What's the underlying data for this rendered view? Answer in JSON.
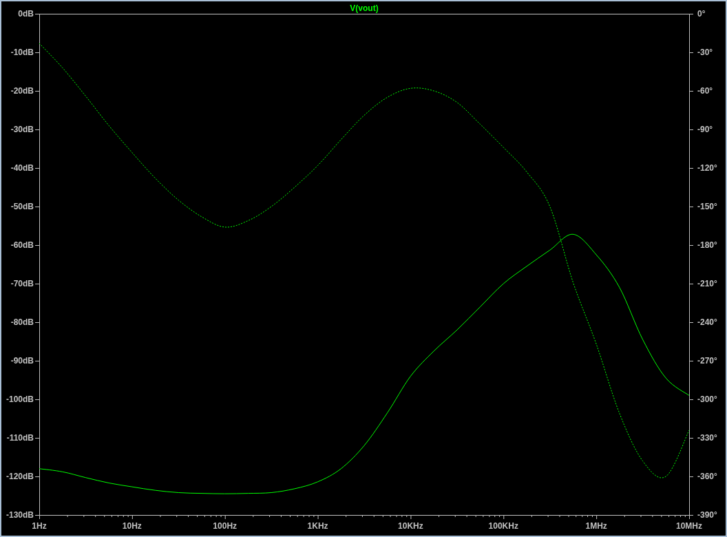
{
  "plot": {
    "magnitude_chart": {
      "chart_data": {
        "type": "line",
        "title": "V(vout)",
        "categories": [
          "1Hz",
          null,
          null,
          null,
          "10Hz",
          null,
          null,
          null,
          "100Hz",
          null,
          null,
          null,
          "1KHz",
          null,
          null,
          null,
          "10KHz",
          null,
          null,
          null,
          "100KHz",
          null,
          null,
          null,
          "1MHz",
          null,
          null,
          null,
          "10MHz"
        ],
        "series": [
          {
            "color": "#00ff00",
            "line_style": "solid",
            "values": [
              -118,
              -118.8,
              -120.3,
              -121.7,
              -122.7,
              -123.6,
              -124.2,
              -124.4,
              -124.5,
              -124.4,
              -124.2,
              -123.2,
              -121.4,
              -118,
              -112,
              -103.5,
              -94,
              -87.5,
              -82,
              -76,
              -70,
              -65.5,
              -61.3,
              -57.2,
              -62.5,
              -71,
              -84.5,
              -94.5,
              -99
            ]
          }
        ],
        "ylim": [
          -130,
          0
        ],
        "yticks": [
          {
            "value": 0,
            "label": "0dB"
          },
          {
            "value": -10,
            "label": "-10dB"
          },
          {
            "value": -20,
            "label": "-20dB"
          },
          {
            "value": -30,
            "label": "-30dB"
          },
          {
            "value": -40,
            "label": "-40dB"
          },
          {
            "value": -50,
            "label": "-50dB"
          },
          {
            "value": -60,
            "label": "-60dB"
          },
          {
            "value": -70,
            "label": "-70dB"
          },
          {
            "value": -80,
            "label": "-80dB"
          },
          {
            "value": -90,
            "label": "-90dB"
          },
          {
            "value": -100,
            "label": "-100dB"
          },
          {
            "value": -110,
            "label": "-110dB"
          },
          {
            "value": -120,
            "label": "-120dB"
          },
          {
            "value": -130,
            "label": "-130dB"
          }
        ]
      }
    },
    "phase_chart": {
      "chart_data": {
        "type": "line",
        "categories": [
          null,
          null,
          null,
          null,
          null,
          null,
          null,
          null,
          null,
          null,
          null,
          null,
          null,
          null,
          null,
          null,
          null,
          null,
          null,
          null,
          null,
          null,
          null,
          null,
          null,
          null,
          null,
          null,
          null
        ],
        "series": [
          {
            "color": "#00ff00",
            "line_style": "dashed",
            "values": [
              -23,
              -42,
              -64,
              -87,
              -108,
              -128,
              -145,
              -158,
              -166,
              -161,
              -150,
              -135,
              -118,
              -98,
              -79,
              -65,
              -58,
              -60,
              -69,
              -86,
              -104,
              -123,
              -150,
              -209,
              -257,
              -311,
              -348,
              -360,
              -324
            ]
          }
        ],
        "ylim": [
          -390,
          0
        ],
        "yticks": [
          {
            "value": 0,
            "label": "0°"
          },
          {
            "value": -30,
            "label": "-30°"
          },
          {
            "value": -60,
            "label": "-60°"
          },
          {
            "value": -90,
            "label": "-90°"
          },
          {
            "value": -120,
            "label": "-120°"
          },
          {
            "value": -150,
            "label": "-150°"
          },
          {
            "value": -180,
            "label": "-180°"
          },
          {
            "value": -210,
            "label": "-210°"
          },
          {
            "value": -240,
            "label": "-240°"
          },
          {
            "value": -270,
            "label": "-270°"
          },
          {
            "value": -300,
            "label": "-300°"
          },
          {
            "value": -330,
            "label": "-330°"
          },
          {
            "value": -360,
            "label": "-360°"
          },
          {
            "value": -390,
            "label": "-390°"
          }
        ]
      }
    }
  }
}
